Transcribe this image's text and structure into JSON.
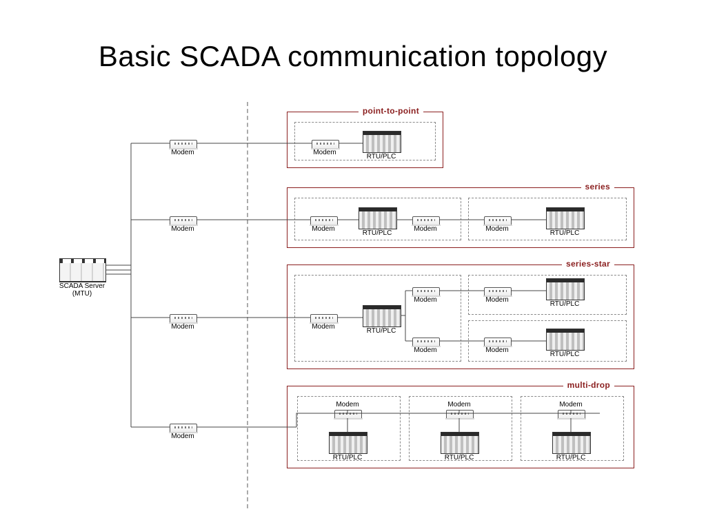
{
  "title": "Basic SCADA communication topology",
  "labels": {
    "server": "SCADA Server\n(MTU)",
    "modem": "Modem",
    "rtuplc": "RTU/PLC"
  },
  "topologies": {
    "p2p": "point-to-point",
    "series": "series",
    "seriesstar": "series-star",
    "multidrop": "multi-drop"
  },
  "colors": {
    "box_border": "#8a1e1e",
    "divider": "#aaa"
  }
}
